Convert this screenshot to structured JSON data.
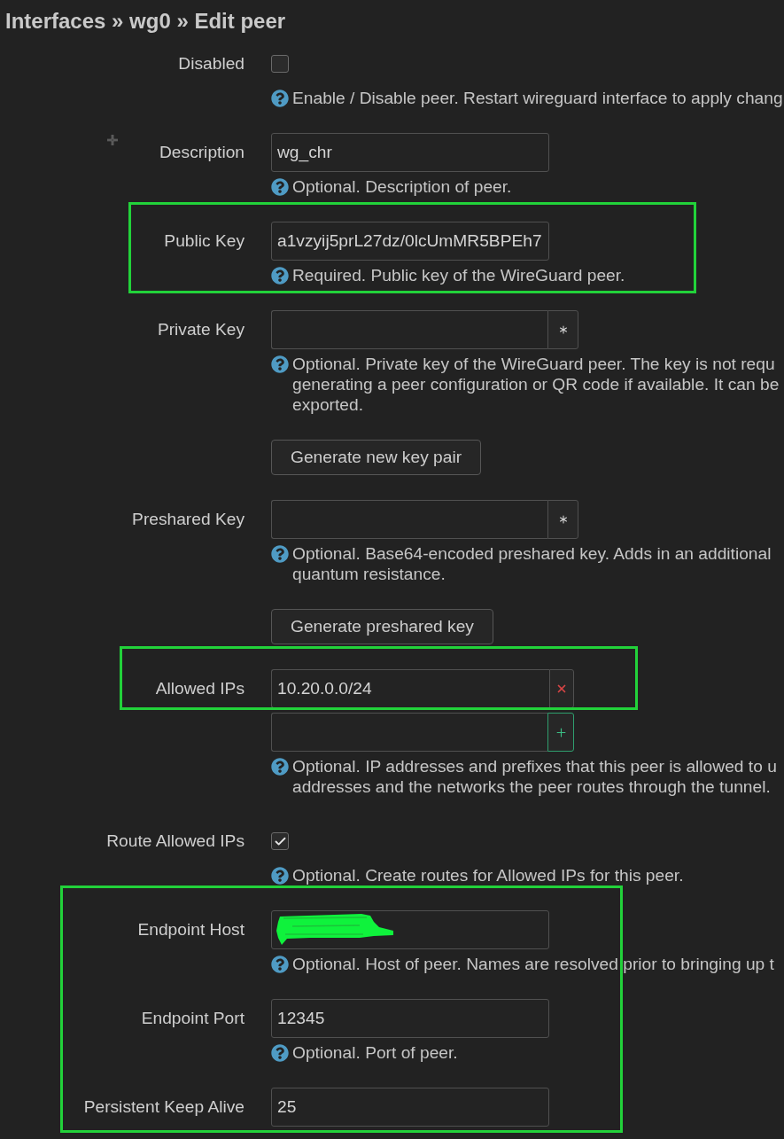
{
  "title": "Interfaces » wg0 » Edit peer",
  "groups": [
    {
      "highlighted": false,
      "rows": [
        {
          "kind": "checkbox",
          "label": "Disabled",
          "checked": false,
          "help": "Enable / Disable peer. Restart wireguard interface to apply chang"
        },
        {
          "kind": "text",
          "label": "Description",
          "value": "wg_chr",
          "help": "Optional. Description of peer."
        }
      ]
    },
    {
      "highlighted": true,
      "rows": [
        {
          "kind": "text",
          "label": "Public Key",
          "value": "a1vzyij5prL27dz/0lcUmMR5BPEh7",
          "help": "Required. Public key of the WireGuard peer."
        }
      ]
    },
    {
      "highlighted": false,
      "rows": [
        {
          "kind": "secret",
          "label": "Private Key",
          "help": "Optional. Private key of the WireGuard peer. The key is not requ\ngenerating a peer configuration or QR code if available. It can be\nexported."
        },
        {
          "kind": "button",
          "button": "Generate new key pair"
        },
        {
          "kind": "secret",
          "label": "Preshared Key",
          "help": "Optional. Base64-encoded preshared key. Adds in an additional\nquantum resistance."
        },
        {
          "kind": "button",
          "button": "Generate preshared key"
        }
      ]
    },
    {
      "highlighted": true,
      "rows": [
        {
          "kind": "list_entry",
          "label": "Allowed IPs",
          "value": "10.20.0.0/24"
        }
      ]
    },
    {
      "highlighted": false,
      "rows": [
        {
          "kind": "list_add",
          "help": "Optional. IP addresses and prefixes that this peer is allowed to u\naddresses and the networks the peer routes through the tunnel."
        },
        {
          "kind": "checkbox",
          "label": "Route Allowed IPs",
          "checked": true,
          "help": "Optional. Create routes for Allowed IPs for this peer."
        }
      ]
    },
    {
      "highlighted": true,
      "rows": [
        {
          "kind": "text",
          "label": "Endpoint Host",
          "redacted": true,
          "help": "Optional. Host of peer. Names are resolved prior to bringing up t"
        },
        {
          "kind": "text",
          "label": "Endpoint Port",
          "value": "12345",
          "help": "Optional. Port of peer."
        },
        {
          "kind": "text",
          "label": "Persistent Keep Alive",
          "value": "25"
        }
      ]
    }
  ]
}
